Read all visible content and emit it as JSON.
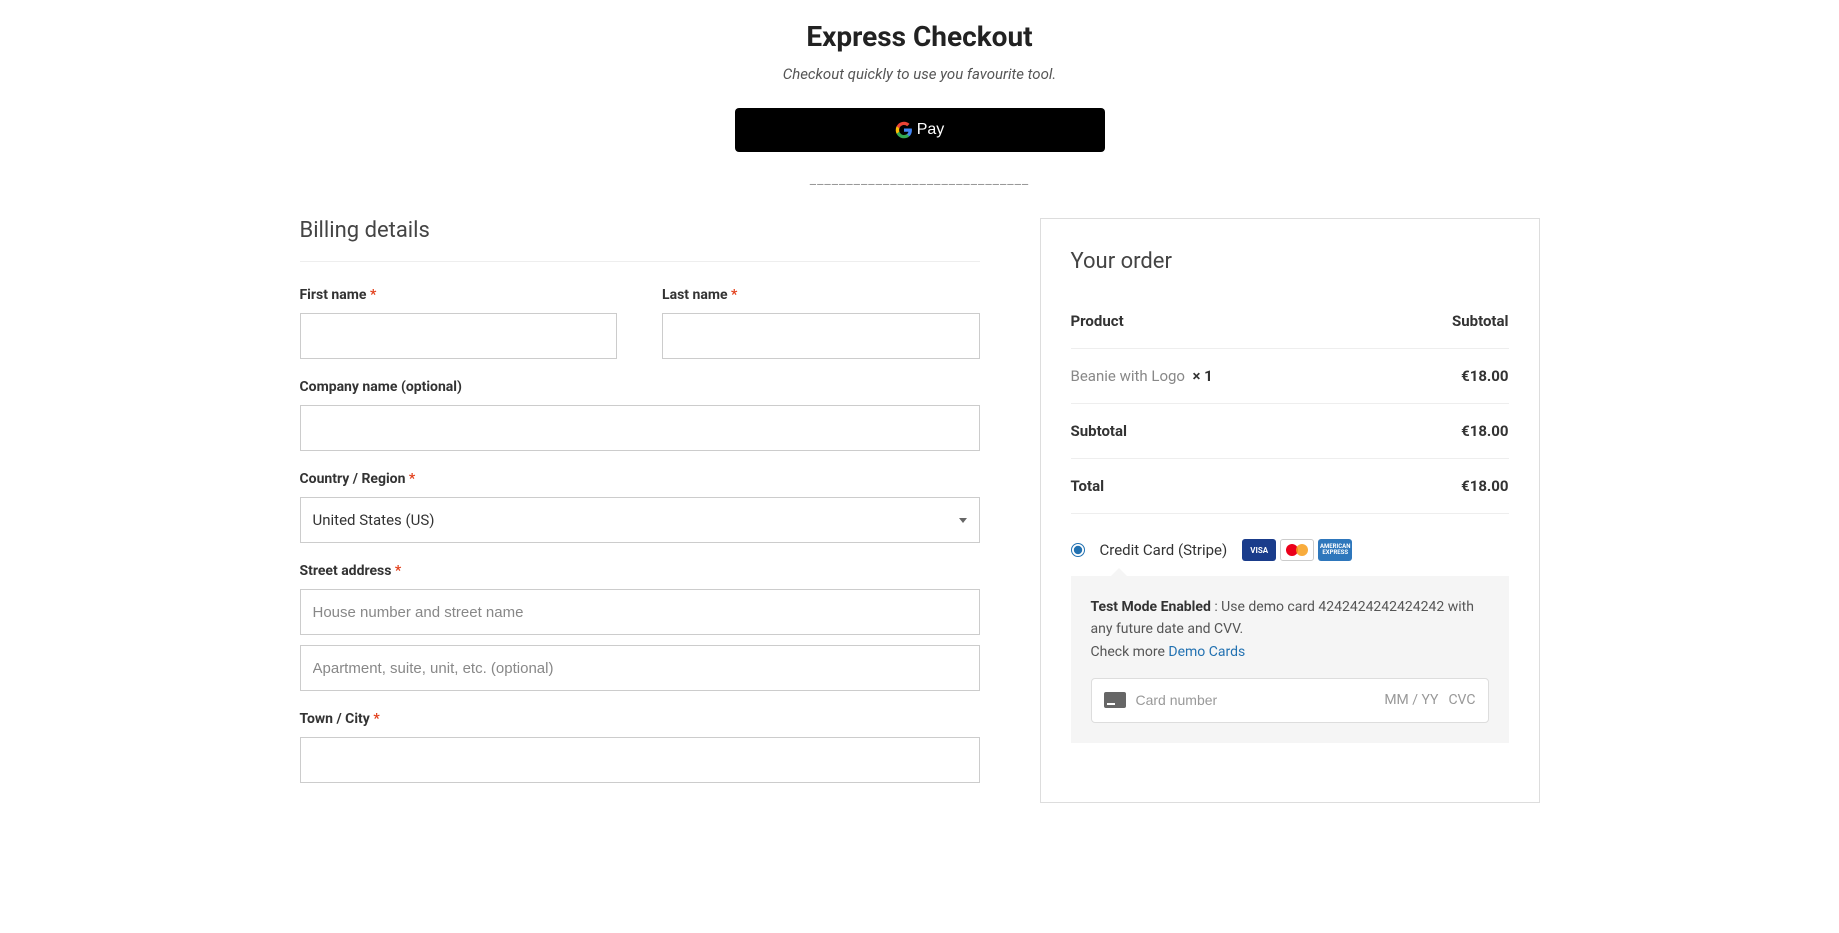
{
  "express": {
    "title": "Express Checkout",
    "subtitle": "Checkout quickly to use you favourite tool.",
    "gpay_label": "Pay",
    "divider": "______________________________"
  },
  "billing": {
    "heading": "Billing details",
    "first_name_label": "First name",
    "last_name_label": "Last name",
    "company_label": "Company name (optional)",
    "country_label": "Country / Region",
    "country_value": "United States (US)",
    "street_label": "Street address",
    "street1_placeholder": "House number and street name",
    "street2_placeholder": "Apartment, suite, unit, etc. (optional)",
    "city_label": "Town / City"
  },
  "order": {
    "heading": "Your order",
    "product_header": "Product",
    "subtotal_header": "Subtotal",
    "item_name": "Beanie with Logo",
    "item_qty": "× 1",
    "item_price": "€18.00",
    "subtotal_label": "Subtotal",
    "subtotal_value": "€18.00",
    "total_label": "Total",
    "total_value": "€18.00"
  },
  "payment": {
    "method_label": "Credit Card (Stripe)",
    "visa_text": "VISA",
    "amex_text": "AMERICAN EXPRESS",
    "test_bold": "Test Mode Enabled",
    "test_rest": " : Use demo card 4242424242424242 with any future date and CVV.",
    "check_more": "Check more ",
    "demo_link": "Demo Cards",
    "card_placeholder": "Card number",
    "expiry_text": "MM / YY",
    "cvc_text": "CVC"
  }
}
